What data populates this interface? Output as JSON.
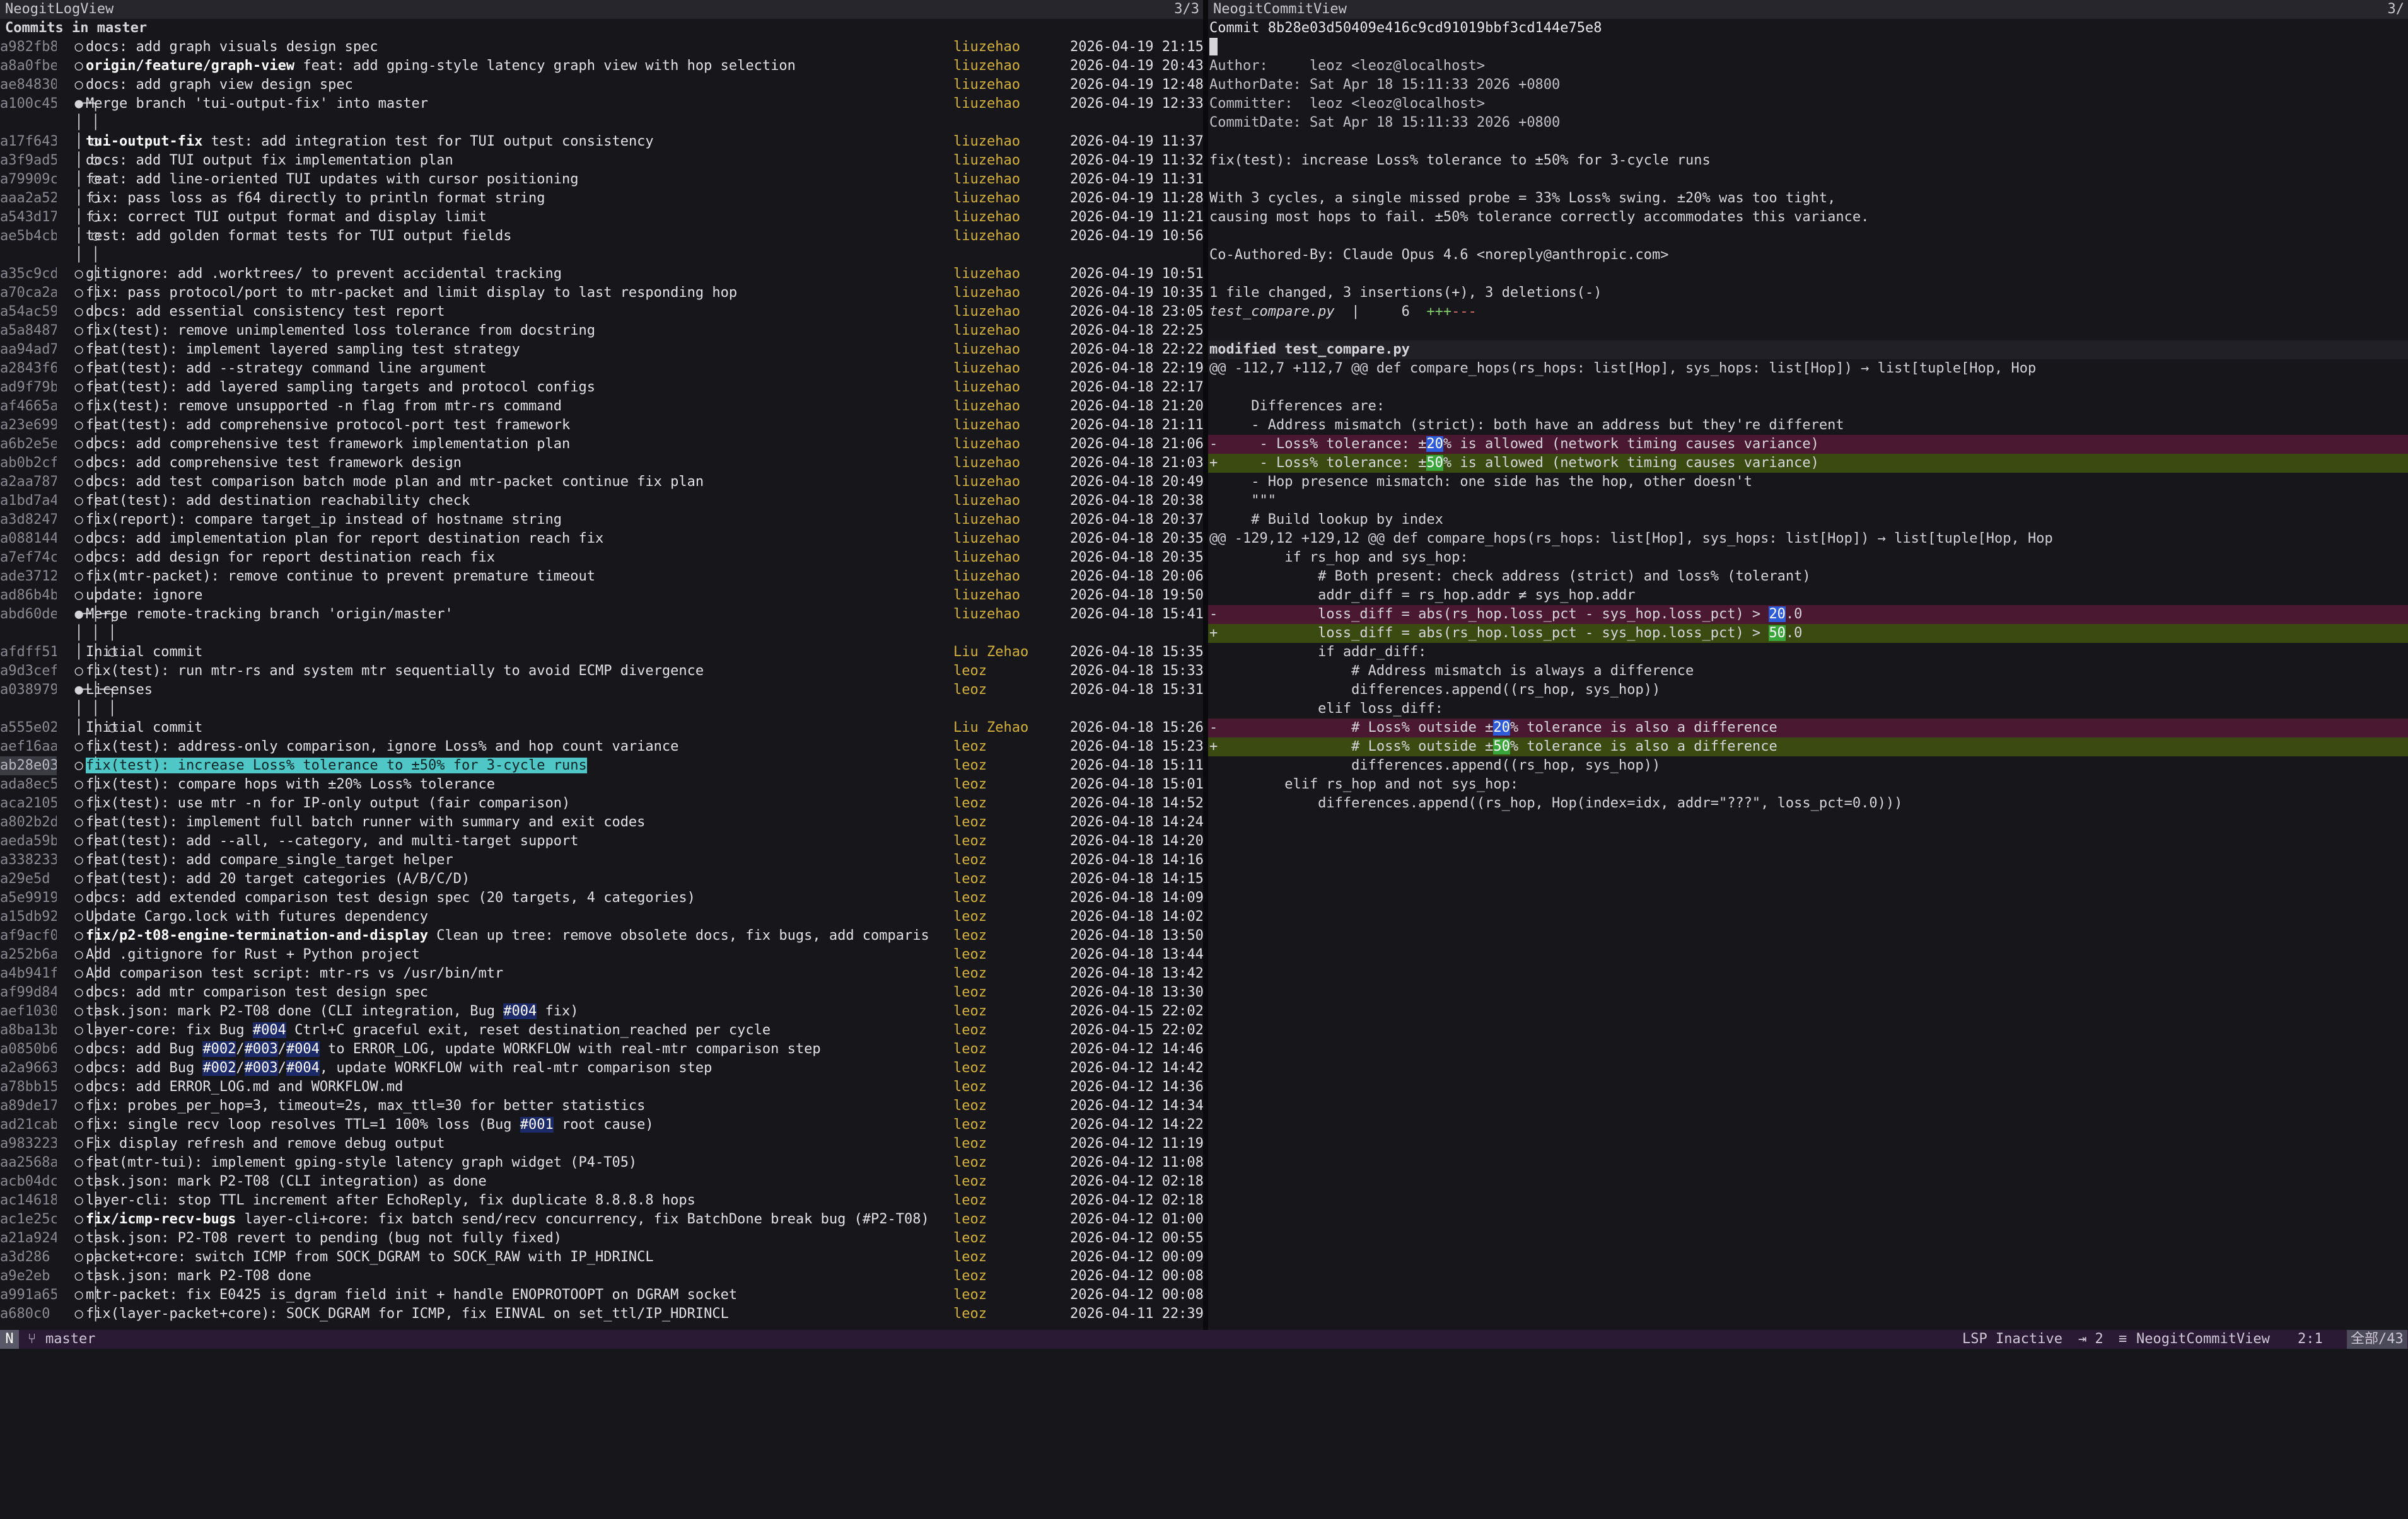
{
  "left": {
    "title": "NeogitLogView",
    "count": "3/3",
    "header": "Commits in master",
    "rows": [
      {
        "hash": "a982fb8",
        "graph": "  ○",
        "ref": "",
        "msg": "docs: add graph visuals design spec",
        "author": "liuzehao",
        "date": "2026-04-19 21:15"
      },
      {
        "hash": "a8a0fbe",
        "graph": "  ○",
        "ref": "origin/feature/graph-view",
        "msg": " feat: add gping-style latency graph view with hop selection",
        "author": "liuzehao",
        "date": "2026-04-19 20:43"
      },
      {
        "hash": "ae84830",
        "graph": "  ○",
        "ref": "",
        "msg": "docs: add graph view design spec",
        "author": "liuzehao",
        "date": "2026-04-19 12:48"
      },
      {
        "hash": "a100c45",
        "graph": "  ●─╮",
        "ref": "",
        "msg": "Merge branch 'tui-output-fix' into master",
        "author": "liuzehao",
        "date": "2026-04-19 12:33"
      },
      {
        "hash": "",
        "graph": "  │ │",
        "ref": "",
        "msg": "",
        "author": "",
        "date": ""
      },
      {
        "hash": "a17f643",
        "graph": "  │ ○",
        "ref": "tui-output-fix",
        "msg": " test: add integration test for TUI output consistency",
        "author": "liuzehao",
        "date": "2026-04-19 11:37"
      },
      {
        "hash": "a3f9ad5",
        "graph": "  │ ○",
        "ref": "",
        "msg": "docs: add TUI output fix implementation plan",
        "author": "liuzehao",
        "date": "2026-04-19 11:32"
      },
      {
        "hash": "a79909c",
        "graph": "  │ ○",
        "ref": "",
        "msg": "feat: add line-oriented TUI updates with cursor positioning",
        "author": "liuzehao",
        "date": "2026-04-19 11:31"
      },
      {
        "hash": "aaa2a52",
        "graph": "  │ ○",
        "ref": "",
        "msg": "fix: pass loss as f64 directly to println format string",
        "author": "liuzehao",
        "date": "2026-04-19 11:28"
      },
      {
        "hash": "a543d17",
        "graph": "  │ ○",
        "ref": "",
        "msg": "fix: correct TUI output format and display limit",
        "author": "liuzehao",
        "date": "2026-04-19 11:21"
      },
      {
        "hash": "ae5b4cb",
        "graph": "  │ ○",
        "ref": "",
        "msg": "test: add golden format tests for TUI output fields",
        "author": "liuzehao",
        "date": "2026-04-19 10:56"
      },
      {
        "hash": "",
        "graph": "  │ │",
        "ref": "",
        "msg": "",
        "author": "",
        "date": ""
      },
      {
        "hash": "a35c9cd",
        "graph": "  ○ │",
        "ref": "",
        "msg": "gitignore: add .worktrees/ to prevent accidental tracking",
        "author": "liuzehao",
        "date": "2026-04-19 10:51"
      },
      {
        "hash": "a70ca2a",
        "graph": "  ○ │",
        "ref": "",
        "msg": "fix: pass protocol/port to mtr-packet and limit display to last responding hop",
        "author": "liuzehao",
        "date": "2026-04-19 10:35"
      },
      {
        "hash": "a54ac59",
        "graph": "  ○ │",
        "ref": "",
        "msg": "docs: add essential consistency test report",
        "author": "liuzehao",
        "date": "2026-04-18 23:05"
      },
      {
        "hash": "a5a8487",
        "graph": "  ○ │",
        "ref": "",
        "msg": "fix(test): remove unimplemented loss tolerance from docstring",
        "author": "liuzehao",
        "date": "2026-04-18 22:25"
      },
      {
        "hash": "aa94ad7",
        "graph": "  ○ │",
        "ref": "",
        "msg": "feat(test): implement layered sampling test strategy",
        "author": "liuzehao",
        "date": "2026-04-18 22:22"
      },
      {
        "hash": "a2843f6",
        "graph": "  ○ │",
        "ref": "",
        "msg": "feat(test): add --strategy command line argument",
        "author": "liuzehao",
        "date": "2026-04-18 22:19"
      },
      {
        "hash": "ad9f79b",
        "graph": "  ○ │",
        "ref": "",
        "msg": "feat(test): add layered sampling targets and protocol configs",
        "author": "liuzehao",
        "date": "2026-04-18 22:17"
      },
      {
        "hash": "af4665a",
        "graph": "  ○ │",
        "ref": "",
        "msg": "fix(test): remove unsupported -n flag from mtr-rs command",
        "author": "liuzehao",
        "date": "2026-04-18 21:20"
      },
      {
        "hash": "a23e699",
        "graph": "  ○ │",
        "ref": "",
        "msg": "feat(test): add comprehensive protocol-port test framework",
        "author": "liuzehao",
        "date": "2026-04-18 21:11"
      },
      {
        "hash": "a6b2e5e",
        "graph": "  ○ │",
        "ref": "",
        "msg": "docs: add comprehensive test framework implementation plan",
        "author": "liuzehao",
        "date": "2026-04-18 21:06"
      },
      {
        "hash": "ab0b2cf",
        "graph": "  ○ │",
        "ref": "",
        "msg": "docs: add comprehensive test framework design",
        "author": "liuzehao",
        "date": "2026-04-18 21:03"
      },
      {
        "hash": "a2aa787",
        "graph": "  ○ │",
        "ref": "",
        "msg": "docs: add test comparison batch mode plan and mtr-packet continue fix plan",
        "author": "liuzehao",
        "date": "2026-04-18 20:49"
      },
      {
        "hash": "a1bd7a4",
        "graph": "  ○ │",
        "ref": "",
        "msg": "feat(test): add destination reachability check",
        "author": "liuzehao",
        "date": "2026-04-18 20:38"
      },
      {
        "hash": "a3d8247",
        "graph": "  ○ │",
        "ref": "",
        "msg": "fix(report): compare target_ip instead of hostname string",
        "author": "liuzehao",
        "date": "2026-04-18 20:37"
      },
      {
        "hash": "a088144",
        "graph": "  ○ │",
        "ref": "",
        "msg": "docs: add implementation plan for report destination reach fix",
        "author": "liuzehao",
        "date": "2026-04-18 20:35"
      },
      {
        "hash": "a7ef74c",
        "graph": "  ○ │",
        "ref": "",
        "msg": "docs: add design for report destination reach fix",
        "author": "liuzehao",
        "date": "2026-04-18 20:35"
      },
      {
        "hash": "ade3712",
        "graph": "  ○ │",
        "ref": "",
        "msg": "fix(mtr-packet): remove continue to prevent premature timeout",
        "author": "liuzehao",
        "date": "2026-04-18 20:06"
      },
      {
        "hash": "ad86b4b",
        "graph": "  ○ │",
        "ref": "",
        "msg": "update: ignore",
        "author": "liuzehao",
        "date": "2026-04-18 19:50"
      },
      {
        "hash": "abd60de",
        "graph": "  ●─│─╮",
        "ref": "",
        "msg": "Merge remote-tracking branch 'origin/master'",
        "author": "liuzehao",
        "date": "2026-04-18 15:41"
      },
      {
        "hash": "",
        "graph": "  │ │ │",
        "ref": "",
        "msg": "",
        "author": "",
        "date": ""
      },
      {
        "hash": "afdff51",
        "graph": "  │ │ ○",
        "ref": "",
        "msg": "Initial commit",
        "author": "Liu Zehao",
        "date": "2026-04-18 15:35"
      },
      {
        "hash": "a9d3cef",
        "graph": "  ○ │",
        "ref": "",
        "msg": "fix(test): run mtr-rs and system mtr sequentially to avoid ECMP divergence",
        "author": "leoz",
        "date": "2026-04-18 15:33"
      },
      {
        "hash": "a038979",
        "graph": "  ●─│─╮",
        "ref": "",
        "msg": "Licenses",
        "author": "leoz",
        "date": "2026-04-18 15:31"
      },
      {
        "hash": "",
        "graph": "  │ │ │",
        "ref": "",
        "msg": "",
        "author": "",
        "date": ""
      },
      {
        "hash": "a555e02",
        "graph": "  │ │ ○",
        "ref": "",
        "msg": "Initial commit",
        "author": "Liu Zehao",
        "date": "2026-04-18 15:26"
      },
      {
        "hash": "aef16aa",
        "graph": "  ○ │",
        "ref": "",
        "msg": "fix(test): address-only comparison, ignore Loss% and hop count variance",
        "author": "leoz",
        "date": "2026-04-18 15:23"
      },
      {
        "hash": "ab28e03",
        "graph": "  ○ │",
        "ref": "",
        "msg": "fix(test): increase Loss% tolerance to ±50% for 3-cycle runs",
        "author": "leoz",
        "date": "2026-04-18 15:11",
        "selected": true
      },
      {
        "hash": "ada8ec5",
        "graph": "  ○ │",
        "ref": "",
        "msg": "fix(test): compare hops with ±20% Loss% tolerance",
        "author": "leoz",
        "date": "2026-04-18 15:01"
      },
      {
        "hash": "aca2105",
        "graph": "  ○ │",
        "ref": "",
        "msg": "fix(test): use mtr -n for IP-only output (fair comparison)",
        "author": "leoz",
        "date": "2026-04-18 14:52"
      },
      {
        "hash": "a802b2d",
        "graph": "  ○ │",
        "ref": "",
        "msg": "feat(test): implement full batch runner with summary and exit codes",
        "author": "leoz",
        "date": "2026-04-18 14:24"
      },
      {
        "hash": "aeda59b",
        "graph": "  ○ │",
        "ref": "",
        "msg": "feat(test): add --all, --category, and multi-target support",
        "author": "leoz",
        "date": "2026-04-18 14:20"
      },
      {
        "hash": "a338233",
        "graph": "  ○ │",
        "ref": "",
        "msg": "feat(test): add compare_single_target helper",
        "author": "leoz",
        "date": "2026-04-18 14:16"
      },
      {
        "hash": "a29e5d",
        "graph": "  ○ │",
        "ref": "",
        "msg": "feat(test): add 20 target categories (A/B/C/D)",
        "author": "leoz",
        "date": "2026-04-18 14:15"
      },
      {
        "hash": "a5e9919",
        "graph": "  ○ │",
        "ref": "",
        "msg": "docs: add extended comparison test design spec (20 targets, 4 categories)",
        "author": "leoz",
        "date": "2026-04-18 14:09"
      },
      {
        "hash": "a15db92",
        "graph": "  ○ │",
        "ref": "",
        "msg": "Update Cargo.lock with futures dependency",
        "author": "leoz",
        "date": "2026-04-18 14:02"
      },
      {
        "hash": "af9acf0",
        "graph": "  ○ │",
        "ref": "fix/p2-t08-engine-termination-and-display",
        "msg": " Clean up tree: remove obsolete docs, fix bugs, add comparis",
        "author": "leoz",
        "date": "2026-04-18 13:50"
      },
      {
        "hash": "a252b6a",
        "graph": "  ○ │",
        "ref": "",
        "msg": "Add .gitignore for Rust + Python project",
        "author": "leoz",
        "date": "2026-04-18 13:44"
      },
      {
        "hash": "a4b941f",
        "graph": "  ○ │",
        "ref": "",
        "msg": "Add comparison test script: mtr-rs vs /usr/bin/mtr",
        "author": "leoz",
        "date": "2026-04-18 13:42"
      },
      {
        "hash": "af99d84c",
        "graph": "  ○ │",
        "ref": "",
        "msg": "docs: add mtr comparison test design spec",
        "author": "leoz",
        "date": "2026-04-18 13:30"
      },
      {
        "hash": "aef1030",
        "graph": "  ○ │",
        "ref": "",
        "msg": "task.json: mark P2-T08 done (CLI integration, Bug #004 fix)",
        "author": "leoz",
        "date": "2026-04-15 22:02"
      },
      {
        "hash": "a8ba13b",
        "graph": "  ○ │",
        "ref": "",
        "msg": "layer-core: fix Bug #004 Ctrl+C graceful exit, reset destination_reached per cycle",
        "author": "leoz",
        "date": "2026-04-15 22:02"
      },
      {
        "hash": "a0850b6",
        "graph": "  ○ │",
        "ref": "",
        "msg": "docs: add Bug #002/#003/#004 to ERROR_LOG, update WORKFLOW with real-mtr comparison step",
        "author": "leoz",
        "date": "2026-04-12 14:46"
      },
      {
        "hash": "a2a9663",
        "graph": "  ○ │",
        "ref": "",
        "msg": "docs: add Bug #002/#003/#004, update WORKFLOW with real-mtr comparison step",
        "author": "leoz",
        "date": "2026-04-12 14:42"
      },
      {
        "hash": "a78bb15",
        "graph": "  ○ │",
        "ref": "",
        "msg": "docs: add ERROR_LOG.md and WORKFLOW.md",
        "author": "leoz",
        "date": "2026-04-12 14:36"
      },
      {
        "hash": "a89de17",
        "graph": "  ○ │",
        "ref": "",
        "msg": "fix: probes_per_hop=3, timeout=2s, max_ttl=30 for better statistics",
        "author": "leoz",
        "date": "2026-04-12 14:34"
      },
      {
        "hash": "ad21cab",
        "graph": "  ○ │",
        "ref": "",
        "msg": "fix: single recv loop resolves TTL=1 100% loss (Bug #001 root cause)",
        "author": "leoz",
        "date": "2026-04-12 14:22"
      },
      {
        "hash": "a983223",
        "graph": "  ○ │",
        "ref": "",
        "msg": "Fix display refresh and remove debug output",
        "author": "leoz",
        "date": "2026-04-12 11:19"
      },
      {
        "hash": "aa2568a",
        "graph": "  ○ │",
        "ref": "",
        "msg": "feat(mtr-tui): implement gping-style latency graph widget (P4-T05)",
        "author": "leoz",
        "date": "2026-04-12 11:08"
      },
      {
        "hash": "acb04dc",
        "graph": "  ○ │",
        "ref": "",
        "msg": "task.json: mark P2-T08 (CLI integration) as done",
        "author": "leoz",
        "date": "2026-04-12 02:18"
      },
      {
        "hash": "ac14618",
        "graph": "  ○ │",
        "ref": "",
        "msg": "layer-cli: stop TTL increment after EchoReply, fix duplicate 8.8.8.8 hops",
        "author": "leoz",
        "date": "2026-04-12 02:18"
      },
      {
        "hash": "ac1e25c6",
        "graph": "  ○ │",
        "ref": "fix/icmp-recv-bugs",
        "msg": " layer-cli+core: fix batch send/recv concurrency, fix BatchDone break bug (#P2-T08)",
        "author": "leoz",
        "date": "2026-04-12 01:00"
      },
      {
        "hash": "a21a924",
        "graph": "  ○ │",
        "ref": "",
        "msg": "task.json: P2-T08 revert to pending (bug not fully fixed)",
        "author": "leoz",
        "date": "2026-04-12 00:55"
      },
      {
        "hash": "a3d286",
        "graph": "  ○ │",
        "ref": "",
        "msg": "packet+core: switch ICMP from SOCK_DGRAM to SOCK_RAW with IP_HDRINCL",
        "author": "leoz",
        "date": "2026-04-12 00:09"
      },
      {
        "hash": "a9e2eb",
        "graph": "  ○ │",
        "ref": "",
        "msg": "task.json: mark P2-T08 done",
        "author": "leoz",
        "date": "2026-04-12 00:08"
      },
      {
        "hash": "a991a65",
        "graph": "  ○ │",
        "ref": "",
        "msg": "mtr-packet: fix E0425 is_dgram field init + handle ENOPROTOOPT on DGRAM socket",
        "author": "leoz",
        "date": "2026-04-12 00:08"
      },
      {
        "hash": "a680c0",
        "graph": "  ○ │",
        "ref": "",
        "msg": "fix(layer-packet+core): SOCK_DGRAM for ICMP, fix EINVAL on set_ttl/IP_HDRINCL",
        "author": "leoz",
        "date": "2026-04-11 22:39"
      }
    ]
  },
  "right": {
    "title": "NeogitCommitView",
    "count": "3/",
    "commit_line": "Commit 8b28e03d50409e416c9cd91019bbf3cd144e75e8",
    "meta": [
      "Author:     leoz <leoz@localhost>",
      "AuthorDate: Sat Apr 18 15:11:33 2026 +0800",
      "Committer:  leoz <leoz@localhost>",
      "CommitDate: Sat Apr 18 15:11:33 2026 +0800"
    ],
    "subject": "fix(test): increase Loss% tolerance to ±50% for 3-cycle runs",
    "body": [
      "With 3 cycles, a single missed probe = 33% Loss% swing. ±20% was too tight,",
      "causing most hops to fail. ±50% tolerance correctly accommodates this variance."
    ],
    "coauthor": "Co-Authored-By: Claude Opus 4.6 <noreply@anthropic.com>",
    "summary": "1 file changed, 3 insertions(+), 3 deletions(-)",
    "stat_file": "test_compare.py",
    "stat_sep": "|",
    "stat_num": "6",
    "stat_plus": "+++",
    "stat_minus": "---",
    "modified": "modified test_compare.py",
    "hunk1": "@@ -112,7 +112,7 @@ def compare_hops(rs_hops: list[Hop], sys_hops: list[Hop]) → list[tuple[Hop, Hop",
    "h1_ctx1": "",
    "h1_ctx2": "     Differences are:",
    "h1_ctx3": "     - Address mismatch (strict): both have an address but they're different",
    "h1_del_pre": "-     - Loss% tolerance: ±",
    "h1_del_num": "20",
    "h1_del_post": "% is allowed (network timing causes variance)",
    "h1_add_pre": "+     - Loss% tolerance: ±",
    "h1_add_num": "50",
    "h1_add_post": "% is allowed (network timing causes variance)",
    "h1_ctx4": "     - Hop presence mismatch: one side has the hop, other doesn't",
    "h1_ctx5": "     \"\"\"",
    "h1_ctx6": "     # Build lookup by index",
    "hunk2": "@@ -129,12 +129,12 @@ def compare_hops(rs_hops: list[Hop], sys_hops: list[Hop]) → list[tuple[Hop, Hop",
    "h2_ctx1": "         if rs_hop and sys_hop:",
    "h2_ctx2": "             # Both present: check address (strict) and loss% (tolerant)",
    "h2_ctx3": "             addr_diff = rs_hop.addr ≠ sys_hop.addr",
    "h2_del1_pre": "-            loss_diff = abs(rs_hop.loss_pct - sys_hop.loss_pct) > ",
    "h2_del1_num": "20",
    "h2_del1_post": ".0",
    "h2_add1_pre": "+            loss_diff = abs(rs_hop.loss_pct - sys_hop.loss_pct) > ",
    "h2_add1_num": "50",
    "h2_add1_post": ".0",
    "h2_ctx4": "             if addr_diff:",
    "h2_ctx5": "                 # Address mismatch is always a difference",
    "h2_ctx6": "                 differences.append((rs_hop, sys_hop))",
    "h2_ctx7": "             elif loss_diff:",
    "h2_del2_pre": "-                # Loss% outside ±",
    "h2_del2_num": "20",
    "h2_del2_post": "% tolerance is also a difference",
    "h2_add2_pre": "+                # Loss% outside ±",
    "h2_add2_num": "50",
    "h2_add2_post": "% tolerance is also a difference",
    "h2_ctx8": "                 differences.append((rs_hop, sys_hop))",
    "h2_ctx9": "         elif rs_hop and not sys_hop:",
    "h2_ctx10": "             differences.append((rs_hop, Hop(index=idx, addr=\"???\", loss_pct=0.0)))"
  },
  "statusbar": {
    "mode": "N",
    "branch": "master",
    "lsp": "LSP Inactive",
    "num": "⇥ 2",
    "view": "NeogitCommitView",
    "pos": "2:1",
    "all": "全部/43"
  }
}
